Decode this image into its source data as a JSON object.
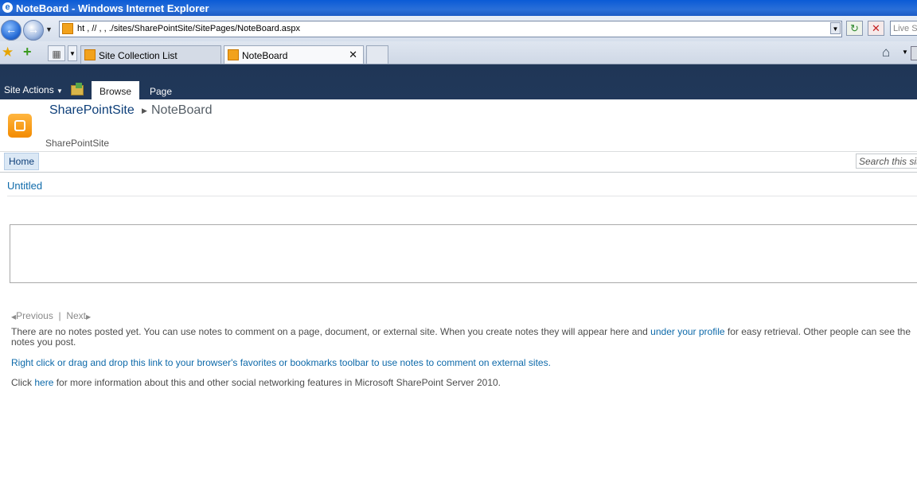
{
  "window": {
    "title": "NoteBoard - Windows Internet Explorer"
  },
  "address_bar": {
    "url": "ht  ,  //               ,  ,        ./sites/SharePointSite/SitePages/NoteBoard.aspx",
    "live_search_placeholder": "Live Se"
  },
  "tabs": [
    {
      "label": "Site Collection List"
    },
    {
      "label": "NoteBoard"
    }
  ],
  "ribbon": {
    "site_actions": "Site Actions",
    "tabs": [
      "Browse",
      "Page"
    ]
  },
  "breadcrumb": {
    "site": "SharePointSite",
    "page": "NoteBoard"
  },
  "site_description": "SharePointSite",
  "top_nav": {
    "home": "Home",
    "search_placeholder": "Search this site..."
  },
  "content": {
    "heading": "Untitled",
    "pager": {
      "previous": "Previous",
      "separator": "|",
      "next": "Next"
    },
    "no_notes_text_1": "There are no notes posted yet. You can use notes to comment on a page, document, or external site. When you create notes they will appear here and ",
    "no_notes_link": "under your profile",
    "no_notes_text_2": " for easy retrieval. Other people can see the notes you post.",
    "bookmarklet_link": "Right click or drag and drop this link to your browser's favorites or bookmarks toolbar to use notes to comment on external sites.",
    "more_info_prefix": "Click ",
    "more_info_link": "here",
    "more_info_suffix": " for more information about this and other social networking features in Microsoft SharePoint Server 2010."
  }
}
